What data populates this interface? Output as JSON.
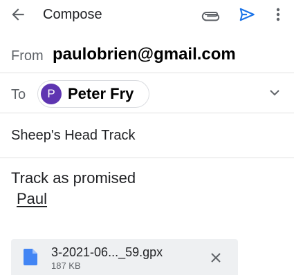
{
  "toolbar": {
    "back_icon": "arrow-back-icon",
    "title": "Compose",
    "attach_icon": "paperclip-icon",
    "send_icon": "send-icon",
    "more_icon": "more-vert-icon",
    "send_color": "#1a73e8"
  },
  "from": {
    "label": "From",
    "value": "paulobrien@gmail.com"
  },
  "to": {
    "label": "To",
    "recipients": [
      {
        "initial": "P",
        "name": "Peter Fry",
        "avatar_color": "#5e35b1"
      }
    ],
    "expand_icon": "chevron-down-icon"
  },
  "subject": "Sheep's Head Track",
  "body": {
    "line1": "Track as promised",
    "line2": "Paul"
  },
  "attachment": {
    "icon": "file-icon",
    "name": "3-2021-06..._59.gpx",
    "size": "187 KB",
    "remove_icon": "close-icon",
    "icon_color": "#4285f4"
  }
}
